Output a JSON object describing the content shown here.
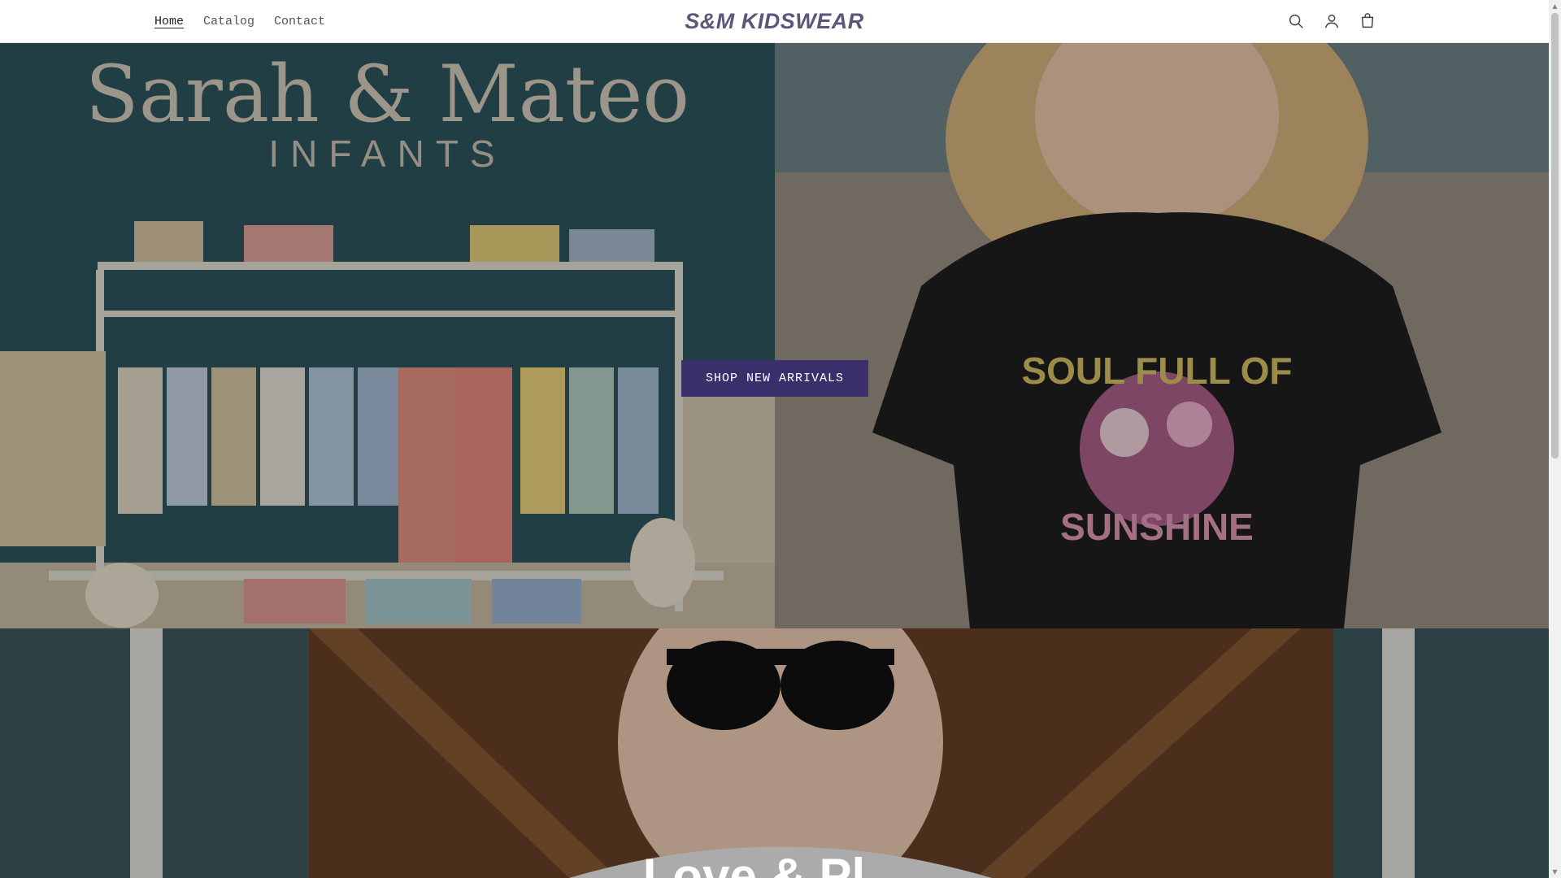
{
  "header": {
    "nav": [
      {
        "label": "Home",
        "active": true
      },
      {
        "label": "Catalog",
        "active": false
      },
      {
        "label": "Contact",
        "active": false
      }
    ],
    "logo": "S&M KIDSWEAR",
    "icons": [
      "search-icon",
      "account-icon",
      "cart-icon"
    ]
  },
  "hero": {
    "left_image_sign_title": "Sarah & Mateo",
    "left_image_sign_subtitle": "INFANTS",
    "cta_label": "SHOP NEW ARRIVALS",
    "right_image_shirt_text_top": "SOUL FULL OF",
    "right_image_shirt_text_bottom": "SUNSHINE"
  },
  "hero2": {
    "heading": "Love & Pl..."
  },
  "colors": {
    "cta_bg": "#3b2f6b",
    "logo": "#5a5878"
  }
}
